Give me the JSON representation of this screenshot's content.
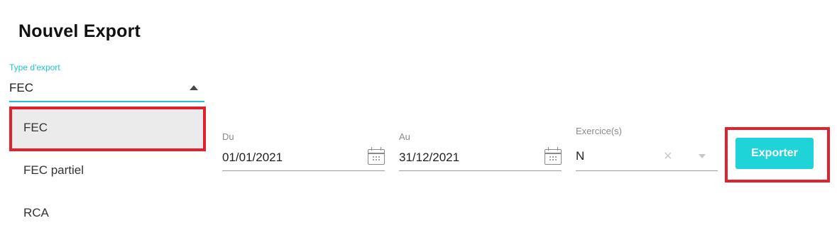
{
  "page": {
    "title": "Nouvel Export"
  },
  "type_export": {
    "label": "Type d'export",
    "value": "FEC",
    "options": [
      "FEC",
      "FEC partiel",
      "RCA"
    ],
    "selected_index": 0
  },
  "date_from": {
    "label": "Du",
    "value": "01/01/2021"
  },
  "date_to": {
    "label": "Au",
    "value": "31/12/2021"
  },
  "exercices": {
    "label": "Exercice(s)",
    "value": "N",
    "clear_icon": "×"
  },
  "actions": {
    "export_label": "Exporter"
  },
  "colors": {
    "accent": "#1ed4d8",
    "highlight": "#e0222c",
    "focus_underline": "#1ec6cf"
  }
}
